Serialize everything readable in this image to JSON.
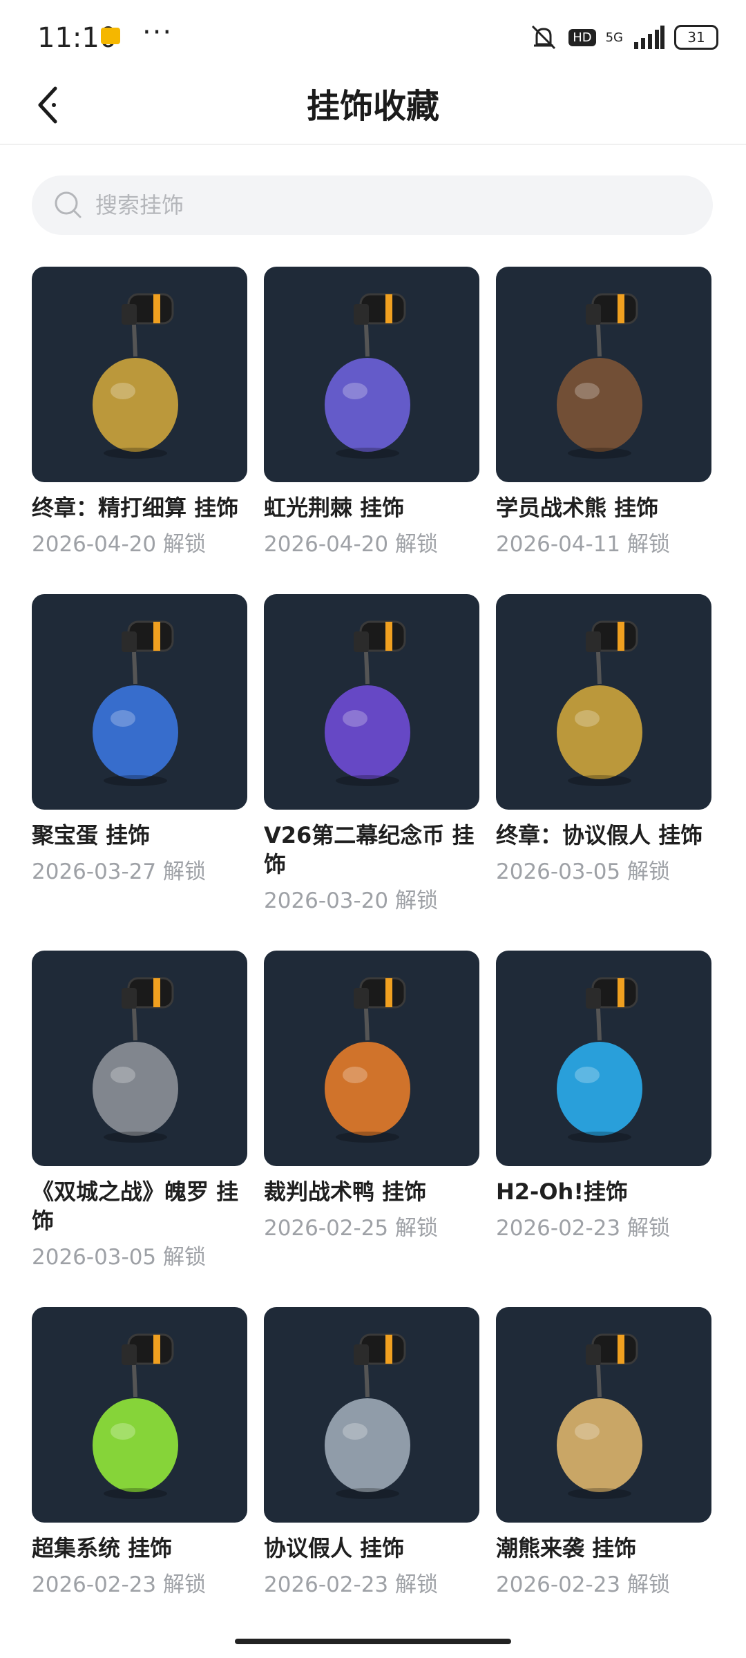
{
  "status": {
    "time": "11:10",
    "dots": "···",
    "hd": "HD",
    "network": "5G",
    "battery": "31"
  },
  "header": {
    "title": "挂饰收藏"
  },
  "search": {
    "placeholder": "搜索挂饰"
  },
  "items": [
    {
      "name": "终章：精打细算 挂饰",
      "date": "2026-04-20 解锁",
      "icon": "gold-pig-charm-icon",
      "color": "#c9a23c"
    },
    {
      "name": "虹光荆棘 挂饰",
      "date": "2026-04-20 解锁",
      "icon": "rainbow-thorn-charm-icon",
      "color": "#6a5fd6"
    },
    {
      "name": "学员战术熊 挂饰",
      "date": "2026-04-11 解锁",
      "icon": "cadet-bear-charm-icon",
      "color": "#7a5236"
    },
    {
      "name": "聚宝蛋 挂饰",
      "date": "2026-03-27 解锁",
      "icon": "treasure-egg-charm-icon",
      "color": "#3a73d9"
    },
    {
      "name": "V26第二幕纪念币 挂饰",
      "date": "2026-03-20 解锁",
      "icon": "v26-coin-charm-icon",
      "color": "#6c4bd1"
    },
    {
      "name": "终章：协议假人 挂饰",
      "date": "2026-03-05 解锁",
      "icon": "gold-dummy-charm-icon",
      "color": "#c9a23c"
    },
    {
      "name": "《双城之战》魄罗 挂饰",
      "date": "2026-03-05 解锁",
      "icon": "poro-charm-icon",
      "color": "#8a8e96"
    },
    {
      "name": "裁判战术鸭 挂饰",
      "date": "2026-02-25 解锁",
      "icon": "referee-duck-charm-icon",
      "color": "#e07a2a"
    },
    {
      "name": "H2-Oh!挂饰",
      "date": "2026-02-23 解锁",
      "icon": "water-bottle-charm-icon",
      "color": "#2aa9e8"
    },
    {
      "name": "超集系统 挂饰",
      "date": "2026-02-23 解锁",
      "icon": "robot-backpack-charm-icon",
      "color": "#8fe33a"
    },
    {
      "name": "协议假人 挂饰",
      "date": "2026-02-23 解锁",
      "icon": "dummy-robot-charm-icon",
      "color": "#9aa6b3"
    },
    {
      "name": "潮熊来袭 挂饰",
      "date": "2026-02-23 解锁",
      "icon": "diver-bear-charm-icon",
      "color": "#d8b16a"
    }
  ]
}
